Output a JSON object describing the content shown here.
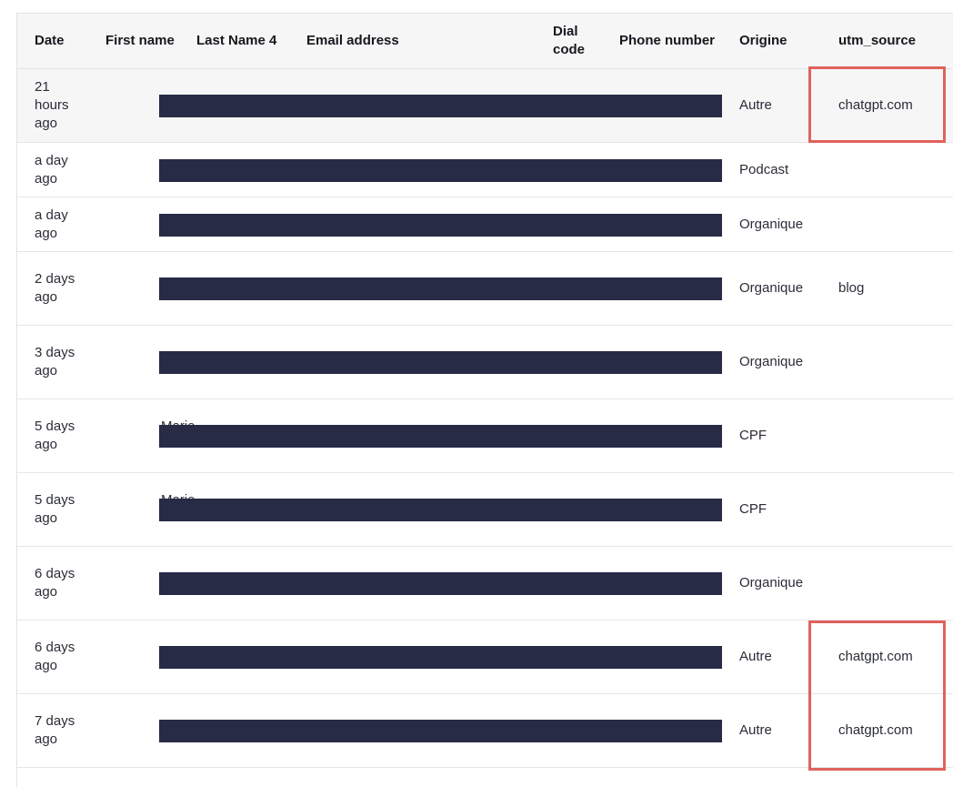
{
  "columns": [
    "Date",
    "First name",
    "Last Name 4",
    "Email address",
    "Dial code",
    "Phone number",
    "Origine",
    "utm_source"
  ],
  "rows": [
    {
      "date": "21 hours ago",
      "peek": "",
      "origine": "Autre",
      "utm_source": "chatgpt.com"
    },
    {
      "date": "a day ago",
      "peek": "",
      "origine": "Podcast",
      "utm_source": ""
    },
    {
      "date": "a day ago",
      "peek": "",
      "origine": "Organique",
      "utm_source": ""
    },
    {
      "date": "2 days ago",
      "peek": "",
      "origine": "Organique",
      "utm_source": "blog"
    },
    {
      "date": "3 days ago",
      "peek": "",
      "origine": "Organique",
      "utm_source": ""
    },
    {
      "date": "5 days ago",
      "peek": "Marie-Charlotte",
      "origine": "CPF",
      "utm_source": ""
    },
    {
      "date": "5 days ago",
      "peek": "Marie-Charlotte",
      "origine": "CPF",
      "utm_source": ""
    },
    {
      "date": "6 days ago",
      "peek": "",
      "origine": "Organique",
      "utm_source": ""
    },
    {
      "date": "6 days ago",
      "peek": "",
      "origine": "Autre",
      "utm_source": "chatgpt.com"
    },
    {
      "date": "7 days ago",
      "peek": "",
      "origine": "Autre",
      "utm_source": "chatgpt.com"
    }
  ],
  "colors": {
    "redaction": "#272b46",
    "callout": "#e0625c",
    "header_bg": "#f6f6f7"
  }
}
